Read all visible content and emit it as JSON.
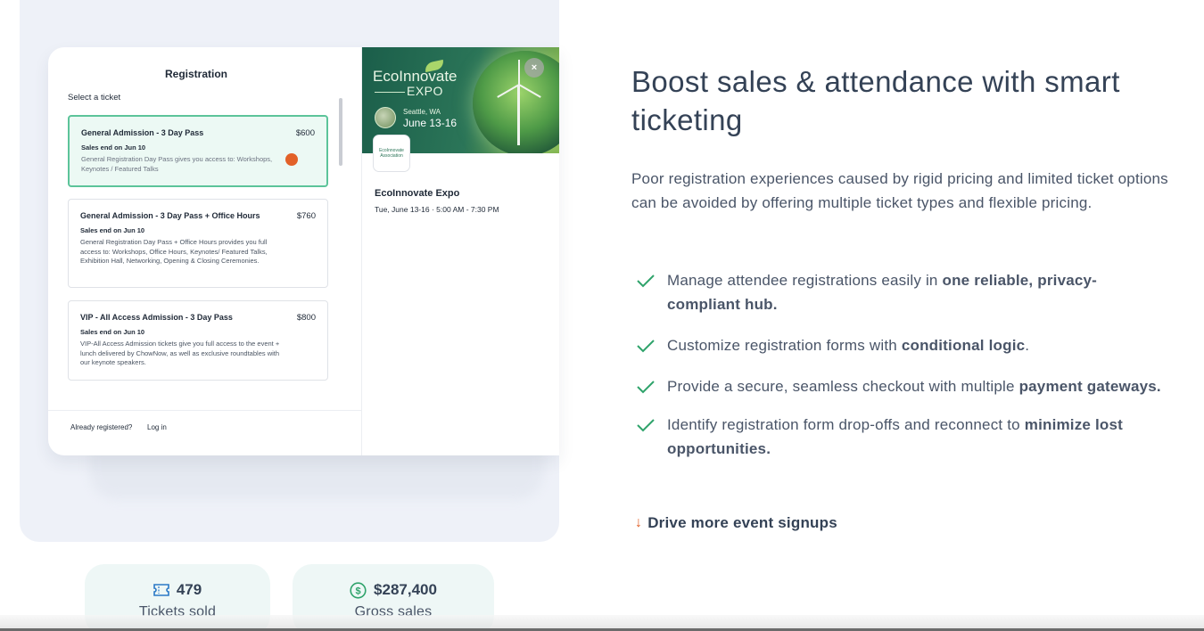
{
  "registration": {
    "title": "Registration",
    "subtitle": "Select a ticket",
    "tickets": [
      {
        "name": "General Admission - 3 Day Pass",
        "price": "$600",
        "sales_end": "Sales end on Jun 10",
        "description": "General Registration Day Pass gives you access to: Workshops, Keynotes / Featured Talks",
        "selected": true
      },
      {
        "name": "General Admission - 3 Day Pass + Office Hours",
        "price": "$760",
        "sales_end": "Sales end on Jun 10",
        "description": "General Registration Day Pass + Office Hours provides you full access to: Workshops, Office Hours, Keynotes/ Featured Talks, Exhibition Hall, Networking, Opening & Closing Ceremonies.",
        "selected": false
      },
      {
        "name": "VIP - All Access Admission - 3 Day Pass",
        "price": "$800",
        "sales_end": "Sales end on Jun 10",
        "description": "VIP-All Access Admission tickets give you full access to the event + lunch delivered by ChowNow, as well as exclusive roundtables with our keynote speakers.",
        "selected": false
      }
    ],
    "footer": {
      "already_registered": "Already registered?",
      "login": "Log in"
    }
  },
  "event": {
    "banner_title": "EcoInnovate",
    "banner_subtitle": "EXPO",
    "banner_location": "Seattle, WA",
    "banner_dates": "June 13-16",
    "org_logo_text": "EcoInnovate Association",
    "name": "EcoInnovate Expo",
    "time": "Tue, June 13-16 · 5:00 AM - 7:30 PM",
    "close_icon": "×"
  },
  "content": {
    "headline": "Boost sales & attendance with smart ticketing",
    "intro": "Poor registration experiences caused by rigid pricing and limited ticket options can be avoided by offering multiple ticket types and flexible pricing.",
    "features": [
      {
        "text": "Manage attendee registrations easily in ",
        "bold": "one reliable, privacy-compliant hub.",
        "after": ""
      },
      {
        "text": "Customize registration forms with ",
        "bold": "conditional logic",
        "after": "."
      },
      {
        "text": "Provide a secure, seamless checkout with multiple ",
        "bold": "payment gateways.",
        "after": ""
      },
      {
        "text": "Identify registration form drop-offs and reconnect to ",
        "bold": "minimize lost opportunities.",
        "after": ""
      }
    ],
    "cta_arrow": "↓",
    "cta": "Drive more event signups"
  },
  "stats": [
    {
      "icon": "ticket-icon",
      "value": "479",
      "label": "Tickets sold"
    },
    {
      "icon": "dollar-icon",
      "value": "$287,400",
      "label": "Gross sales"
    }
  ],
  "colors": {
    "accent_green": "#2fa36b",
    "accent_orange": "#e26128",
    "text": "#344256"
  }
}
